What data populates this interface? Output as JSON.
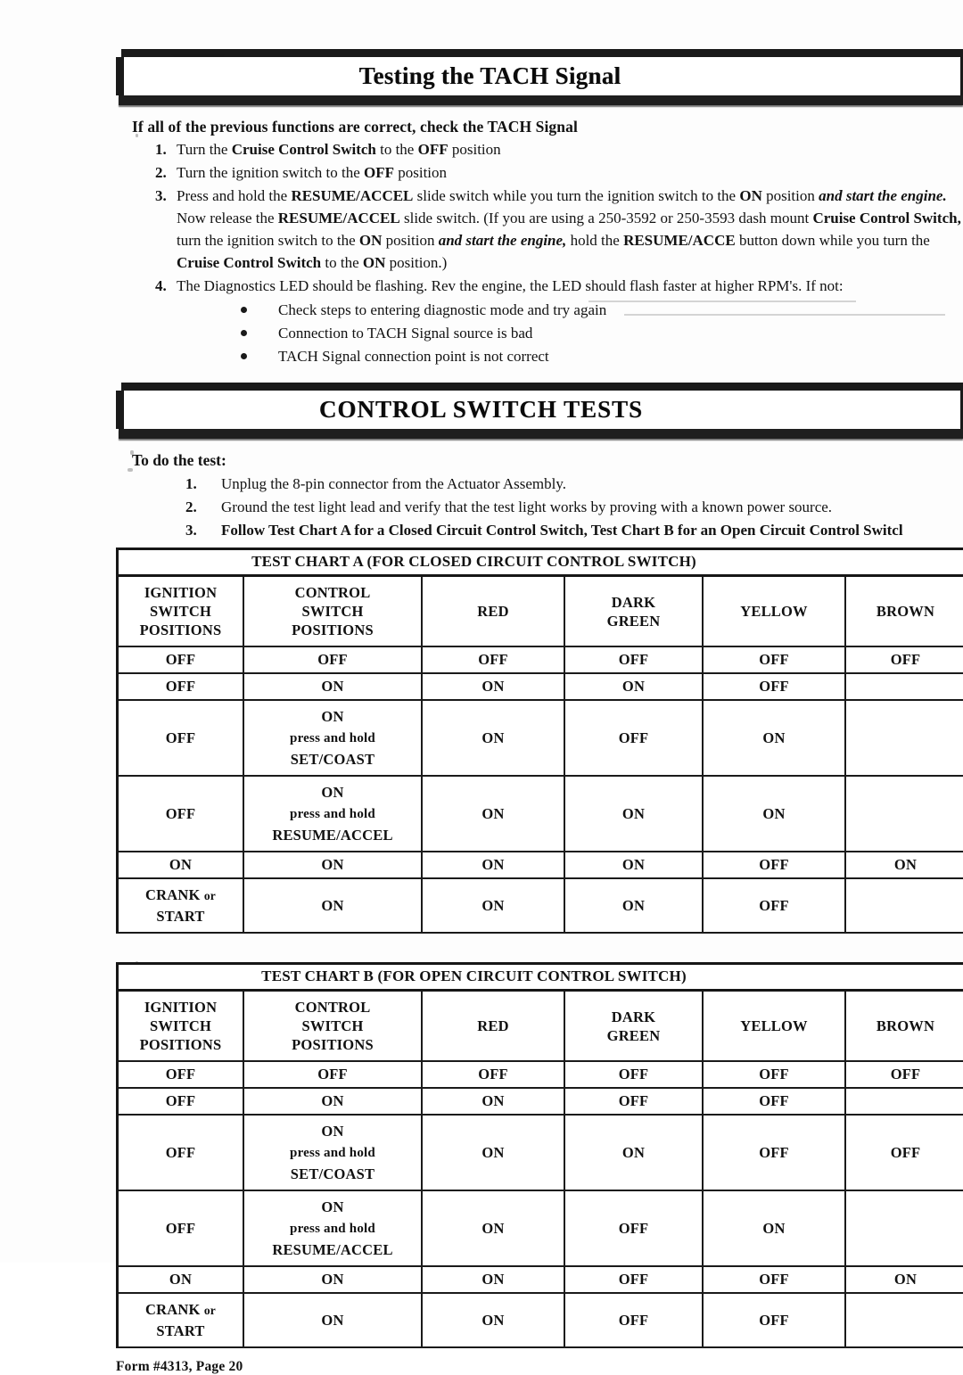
{
  "section1": {
    "banner_title": "Testing the TACH Signal",
    "lead_bold": "If all of",
    "lead_rest": " the previous functions are correct, check the TACH Signal",
    "steps": [
      {
        "num": "1.",
        "html": "Turn the <b>Cruise Control Switch</b> to the <b>OFF</b> position"
      },
      {
        "num": "2.",
        "html": "Turn the ignition switch to the <b>OFF</b> position"
      },
      {
        "num": "3.",
        "html": "Press and hold the <b>RESUME/ACCEL</b> slide switch while you turn the ignition switch to the <b>ON</b> position <i><b>and start the engine.</b></i> Now release the <b>RESUME/ACCEL</b> slide switch. (If you are using a 250-3592 or 250-3593 dash mount <b>Cruise Control Switch,</b> turn the ignition switch to the <b>ON</b> position <i><b>and start the engine,</b></i> hold the <b>RESUME/ACCE</b> button down while you turn the <b>Cruise Control Switch</b> to the <b>ON</b> position.)"
      },
      {
        "num": "4.",
        "html": "The Diagnostics LED should be flashing. Rev the engine, the LED should flash faster at higher RPM's. If not:"
      }
    ],
    "bullets": [
      "Check steps to entering diagnostic mode and try again",
      "Connection to TACH Signal source is bad",
      "TACH Signal connection point is not correct"
    ]
  },
  "section2": {
    "banner_title": "CONTROL SWITCH TESTS",
    "todo_title": "To do the test:",
    "steps": [
      {
        "num": "1.",
        "text": "Unplug the 8-pin connector from the Actuator Assembly.",
        "strong": false
      },
      {
        "num": "2.",
        "text": "Ground the test light lead and verify that the test light works by proving with a known power source.",
        "strong": false
      },
      {
        "num": "3.",
        "text": "Follow Test Chart A for a Closed Circuit Control Switch, Test Chart B for an Open Circuit  Control Switcl",
        "strong": true
      }
    ]
  },
  "chart_data": [
    {
      "type": "table",
      "id": "chart-a",
      "title": "TEST CHART A",
      "subtitle": "(FOR CLOSED CIRCUIT CONTROL SWITCH)",
      "caption": "TEST CHART A    (FOR CLOSED CIRCUIT CONTROL SWITCH)",
      "columns": [
        "IGNITION\nSWITCH\nPOSITIONS",
        "CONTROL\nSWITCH\nPOSITIONS",
        "RED",
        "DARK\nGREEN",
        "YELLOW",
        "BROWN"
      ],
      "column_lines": [
        [
          "IGNITION",
          "SWITCH",
          "POSITIONS"
        ],
        [
          "CONTROL",
          "SWITCH",
          "POSITIONS"
        ],
        [
          "RED"
        ],
        [
          "DARK",
          "GREEN"
        ],
        [
          "YELLOW"
        ],
        [
          "BROWN"
        ]
      ],
      "rows": [
        {
          "ignition": [
            "OFF"
          ],
          "control": [
            "OFF"
          ],
          "red": "OFF",
          "dark_green": "OFF",
          "yellow": "OFF",
          "brown": "OFF"
        },
        {
          "ignition": [
            "OFF"
          ],
          "control": [
            "ON"
          ],
          "red": "ON",
          "dark_green": "ON",
          "yellow": "OFF",
          "brown": ""
        },
        {
          "ignition": [
            "OFF"
          ],
          "control": [
            "ON",
            "press and hold",
            "SET/COAST"
          ],
          "red": "ON",
          "dark_green": "OFF",
          "yellow": "ON",
          "brown": ""
        },
        {
          "ignition": [
            "OFF"
          ],
          "control": [
            "ON",
            "press and hold",
            "RESUME/ACCEL"
          ],
          "red": "ON",
          "dark_green": "ON",
          "yellow": "ON",
          "brown": ""
        },
        {
          "ignition": [
            "ON"
          ],
          "control": [
            "ON"
          ],
          "red": "ON",
          "dark_green": "ON",
          "yellow": "OFF",
          "brown": "ON"
        },
        {
          "ignition": [
            "CRANK or",
            "START"
          ],
          "control": [
            "ON"
          ],
          "red": "ON",
          "dark_green": "ON",
          "yellow": "OFF",
          "brown": ""
        }
      ]
    },
    {
      "type": "table",
      "id": "chart-b",
      "title": "TEST CHART B",
      "subtitle": "(FOR OPEN CIRCUIT CONTROL SWITCH)",
      "caption": "TEST CHART B    (FOR OPEN CIRCUIT CONTROL SWITCH)",
      "columns": [
        "IGNITION\nSWITCH\nPOSITIONS",
        "CONTROL\nSWITCH\nPOSITIONS",
        "RED",
        "DARK\nGREEN",
        "YELLOW",
        "BROWN"
      ],
      "column_lines": [
        [
          "IGNITION",
          "SWITCH",
          "POSITIONS"
        ],
        [
          "CONTROL",
          "SWITCH",
          "POSITIONS"
        ],
        [
          "RED"
        ],
        [
          "DARK",
          "GREEN"
        ],
        [
          "YELLOW"
        ],
        [
          "BROWN"
        ]
      ],
      "rows": [
        {
          "ignition": [
            "OFF"
          ],
          "control": [
            "OFF"
          ],
          "red": "OFF",
          "dark_green": "OFF",
          "yellow": "OFF",
          "brown": "OFF"
        },
        {
          "ignition": [
            "OFF"
          ],
          "control": [
            "ON"
          ],
          "red": "ON",
          "dark_green": "OFF",
          "yellow": "OFF",
          "brown": ""
        },
        {
          "ignition": [
            "OFF"
          ],
          "control": [
            "ON",
            "press and hold",
            "SET/COAST"
          ],
          "red": "ON",
          "dark_green": "ON",
          "yellow": "OFF",
          "brown": "OFF"
        },
        {
          "ignition": [
            "OFF"
          ],
          "control": [
            "ON",
            "press and hold",
            "RESUME/ACCEL"
          ],
          "red": "ON",
          "dark_green": "OFF",
          "yellow": "ON",
          "brown": ""
        },
        {
          "ignition": [
            "ON"
          ],
          "control": [
            "ON"
          ],
          "red": "ON",
          "dark_green": "OFF",
          "yellow": "OFF",
          "brown": "ON"
        },
        {
          "ignition": [
            "CRANK or",
            "START"
          ],
          "control": [
            "ON"
          ],
          "red": "ON",
          "dark_green": "OFF",
          "yellow": "OFF",
          "brown": ""
        }
      ]
    }
  ],
  "footer": "Form #4313, Page 20"
}
